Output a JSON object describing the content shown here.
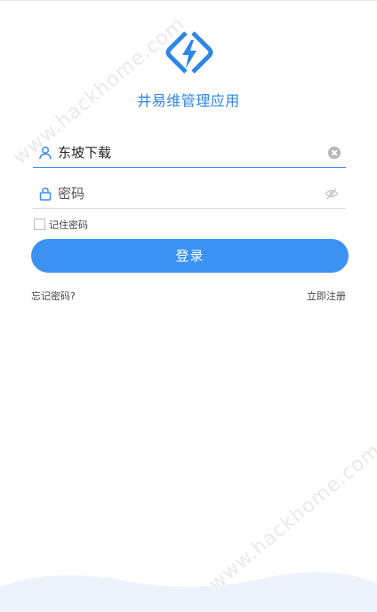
{
  "app": {
    "name": "井易维管理应用"
  },
  "login": {
    "username_value": "东坡下载",
    "password_placeholder": "密码",
    "remember_label": "记住密码",
    "login_button": "登录",
    "forgot_link": "忘记密码?",
    "register_link": "立即注册"
  },
  "watermarks": [
    "www.hackhome.com",
    "www.hackhome.com"
  ],
  "colors": {
    "accent": "#3c92f2",
    "accent_text": "#2f86e4",
    "wave": "#eef2fb"
  },
  "icons": {
    "logo": "lightning-diamond-logo",
    "user": "user-icon",
    "lock": "lock-icon",
    "clear": "clear-icon",
    "eye": "eye-hidden-icon"
  }
}
